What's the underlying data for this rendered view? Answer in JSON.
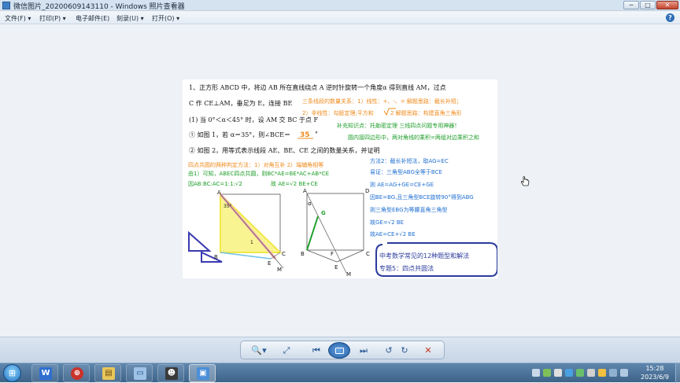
{
  "window": {
    "title": "微信图片_20200609143110 - Windows 照片查看器",
    "controls": {
      "minimize": "─",
      "maximize": "□",
      "close": "✕"
    }
  },
  "menu": {
    "items": [
      {
        "label": "文件(F) ▾"
      },
      {
        "label": "打印(P) ▾"
      },
      {
        "label": "电子邮件(E)"
      },
      {
        "label": "刻录(U) ▾"
      },
      {
        "label": "打开(O) ▾"
      }
    ],
    "help": "?"
  },
  "photo": {
    "problem_line1": "1、正方形 ABCD 中，将边 AB 所在直线绕点 A 逆时针旋转一个角度α 得到直线 AM，过点",
    "problem_line2": "C 作 CE⊥AM，垂足为 E，连接 BE",
    "problem_line3": "(1) 当 0°＜α＜45° 时，设 AM 交 BC 于点 F",
    "problem_line4": "① 如图 1，若 α＝35°，则∠BCE＝",
    "answer_35": "35",
    "degree": "°",
    "problem_line5": "② 如图 2，用等式表示线段 AE、BE、CE 之间的数量关系，并证明",
    "note_orange1": "三条线段的数量关系：1）线性：+、-、= 解题思路：截长补短；",
    "note_orange2": "2）非线性：勾股定理;平方和",
    "note_orange2b": "2 解题思路：构建直角三角形",
    "note_green1": "补充知识点：托勒密定理   三线四点问题专用神器！",
    "note_green2": "圆内接四边形中，两对角线的乘积=两组对边乘积之和",
    "note_left1": "四点共圆的两种判定方法：1）对角互补  2）端辅角相等",
    "note_left2": "由1）可知，ABEC四点共圆，则BC*AE=BE*AC+AB*CE",
    "note_left3": "因AB:BC:AC=1:1:√2",
    "note_left4": "故 AE=√2 BE+CE",
    "note_right1": "方法2：截长补短法，取AG=EC",
    "note_right2": "易证：三角型ABG全等于BCE",
    "note_right3": "则 AE=AG+GE=CE+GE",
    "note_right4": "因BE=BG,且三角型BCE旋转90°得到ABG",
    "note_right5": "则三角型EBG为等腰直角三角型",
    "note_right6": "故GE=√2 BE",
    "note_right7": "故AE=CE+√2 BE",
    "box_line1": "中考数学常见的12种题型和解法",
    "box_line2": "专题5：四点共圆法",
    "fig": {
      "A": "A",
      "B": "B",
      "C": "C",
      "D": "D",
      "E": "E",
      "F": "F",
      "M": "M",
      "G": "G",
      "angle35": "35°",
      "alpha": "α",
      "one": "1"
    }
  },
  "viewer_toolbar": {
    "zoom": "🔍▾",
    "fit": "⤢",
    "previous": "⏮",
    "next": "⏭",
    "rotate_ccw": "↺",
    "rotate_cw": "↻",
    "delete": "✕"
  },
  "taskbar": {
    "start": "⊞",
    "tasks": [
      {
        "label": "W"
      },
      {
        "label": "⊕"
      },
      {
        "label": "▤"
      },
      {
        "label": "▭"
      },
      {
        "label": "☻"
      },
      {
        "label": "▣"
      }
    ],
    "time": "15:28",
    "date": "2023/6/9"
  },
  "colors": {
    "orange": "#ef8a1c",
    "green": "#1e9e2a",
    "blue": "#1f6fd1",
    "yellow": "#f2e84a",
    "pink": "#f2a7b5",
    "red": "#d22a2a"
  }
}
